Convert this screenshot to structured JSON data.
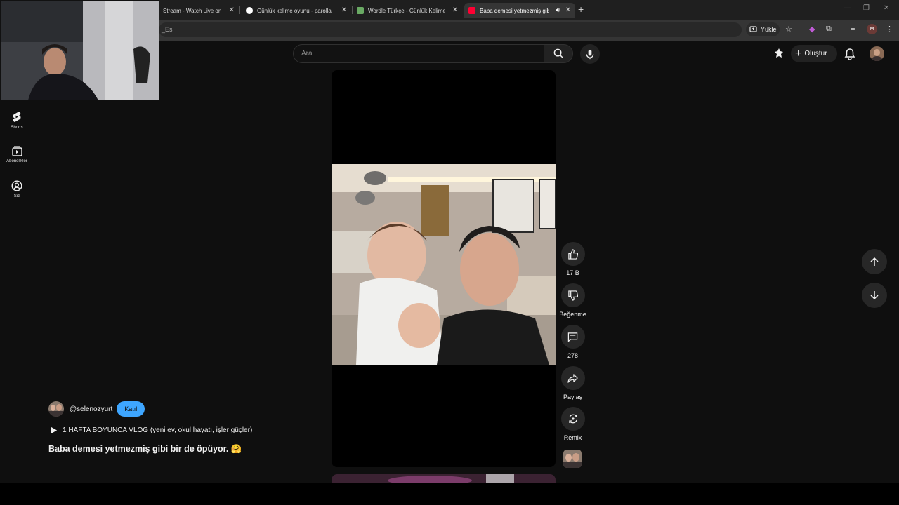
{
  "browser": {
    "tabs": [
      {
        "title": "Stream - Watch Live on",
        "favicon_color": "#9146ff",
        "active": false
      },
      {
        "title": "Günlük kelime oyunu - parolla",
        "favicon_color": "#ffffff",
        "active": false
      },
      {
        "title": "Wordle Türkçe - Günlük Kelime",
        "favicon_color": "#6aaa64",
        "active": false
      },
      {
        "title": "Baba demesi yetmezmiş gibi",
        "favicon_color": "#ff0033",
        "active": true
      }
    ],
    "url_fragment": "_Es",
    "upload_label": "Yükle",
    "profile_initial": "M"
  },
  "youtube": {
    "search_placeholder": "Ara",
    "create_label": "Oluştur",
    "sidebar": [
      {
        "label": "Shorts",
        "icon": "shorts-icon"
      },
      {
        "label": "Abonelikler",
        "icon": "subscriptions-icon"
      },
      {
        "label": "Siz",
        "icon": "you-icon"
      }
    ],
    "actions": {
      "like_count": "17 B",
      "dislike_label": "Beğenme",
      "comment_count": "278",
      "share_label": "Paylaş",
      "remix_label": "Remix"
    },
    "short": {
      "channel": "@selenozyurt",
      "join_label": "Katıl",
      "playlist": "1 HAFTA BOYUNCA VLOG (yeni ev, okul hayatı, işler güçler)",
      "title": "Baba demesi yetmezmiş gibi bir de öpüyor. 🤗"
    },
    "colors": {
      "accent": "#3ea6ff",
      "background": "#0f0f0f"
    }
  }
}
